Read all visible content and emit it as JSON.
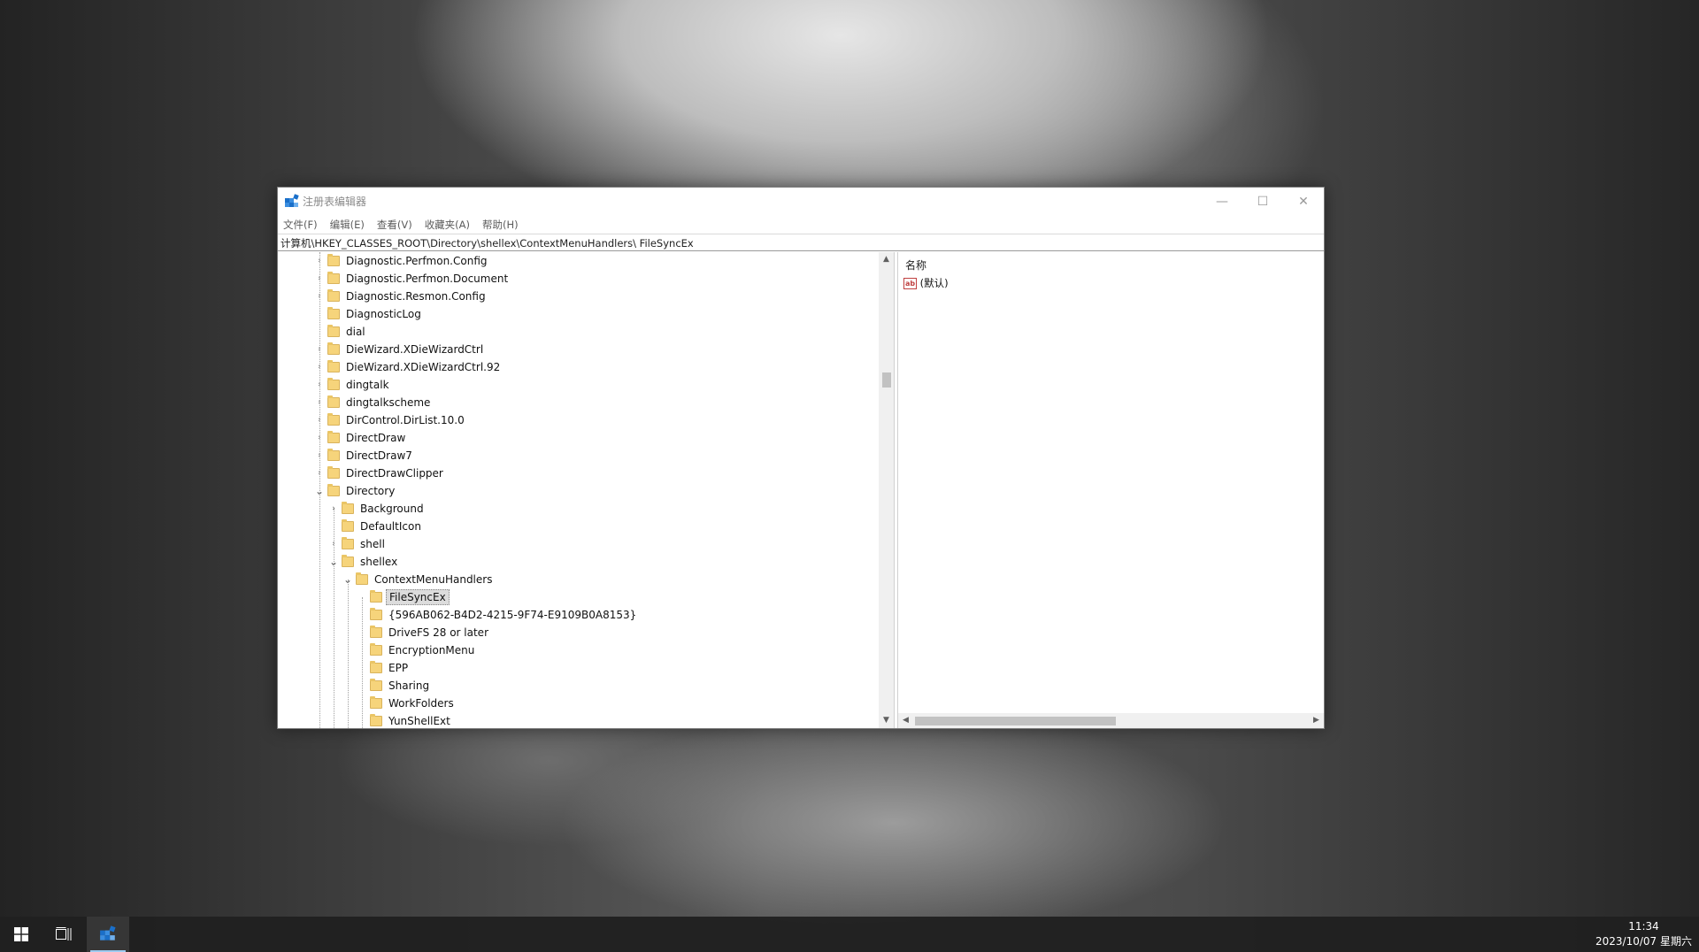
{
  "window": {
    "title": "注册表编辑器",
    "controls": {
      "minimize": "—",
      "maximize": "☐",
      "close": "✕"
    }
  },
  "menubar": {
    "items": [
      "文件(F)",
      "编辑(E)",
      "查看(V)",
      "收藏夹(A)",
      "帮助(H)"
    ]
  },
  "address": "计算机\\HKEY_CLASSES_ROOT\\Directory\\shellex\\ContextMenuHandlers\\ FileSyncEx",
  "tree": {
    "items": [
      {
        "label": "Diagnostic.Perfmon.Config",
        "expander": "›"
      },
      {
        "label": "Diagnostic.Perfmon.Document",
        "expander": "›"
      },
      {
        "label": "Diagnostic.Resmon.Config",
        "expander": "›"
      },
      {
        "label": "DiagnosticLog",
        "expander": ""
      },
      {
        "label": "dial",
        "expander": ""
      },
      {
        "label": "DieWizard.XDieWizardCtrl",
        "expander": "›"
      },
      {
        "label": "DieWizard.XDieWizardCtrl.92",
        "expander": "›"
      },
      {
        "label": "dingtalk",
        "expander": "›"
      },
      {
        "label": "dingtalkscheme",
        "expander": "›"
      },
      {
        "label": "DirControl.DirList.10.0",
        "expander": "›"
      },
      {
        "label": "DirectDraw",
        "expander": "›"
      },
      {
        "label": "DirectDraw7",
        "expander": "›"
      },
      {
        "label": "DirectDrawClipper",
        "expander": "›"
      },
      {
        "label": "Directory",
        "expander": "⌄"
      },
      {
        "label": "Background",
        "expander": "›"
      },
      {
        "label": "DefaultIcon",
        "expander": ""
      },
      {
        "label": "shell",
        "expander": "›"
      },
      {
        "label": "shellex",
        "expander": "⌄"
      },
      {
        "label": "ContextMenuHandlers",
        "expander": "⌄"
      },
      {
        "label": "FileSyncEx",
        "expander": ""
      },
      {
        "label": "{596AB062-B4D2-4215-9F74-E9109B0A8153}",
        "expander": ""
      },
      {
        "label": "DriveFS 28 or later",
        "expander": ""
      },
      {
        "label": "EncryptionMenu",
        "expander": ""
      },
      {
        "label": "EPP",
        "expander": ""
      },
      {
        "label": "Sharing",
        "expander": ""
      },
      {
        "label": "WorkFolders",
        "expander": ""
      },
      {
        "label": "YunShellExt",
        "expander": ""
      }
    ],
    "selected": "FileSyncEx"
  },
  "values": {
    "column_name": "名称",
    "rows": [
      {
        "icon": "ab-string-icon",
        "icon_text": "ab",
        "name": "(默认)"
      }
    ]
  },
  "taskbar": {
    "time": "11:34",
    "date": "2023/10/07 星期六"
  }
}
